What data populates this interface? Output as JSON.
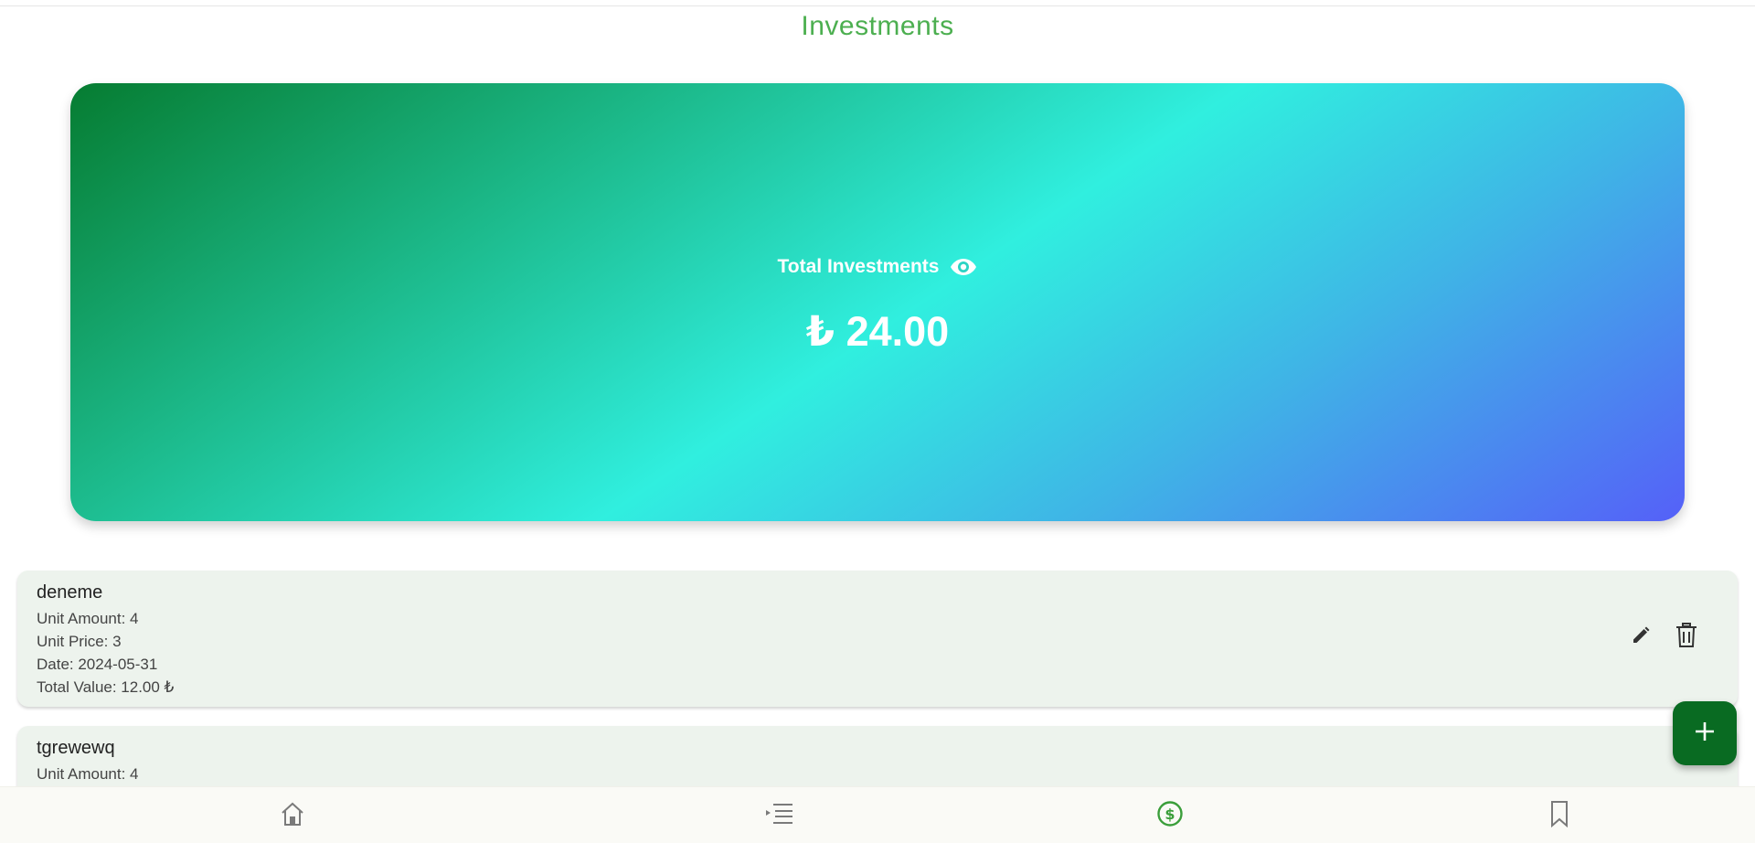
{
  "page": {
    "title": "Investments"
  },
  "summary": {
    "label": "Total Investments",
    "value": "₺ 24.00",
    "visibility_icon": "eye-icon"
  },
  "investments": [
    {
      "name": "deneme",
      "unit_amount": "Unit Amount: 4",
      "unit_price": "Unit Price: 3",
      "date": "Date: 2024-05-31",
      "total_value": "Total Value: 12.00 ₺"
    },
    {
      "name": "tgrewewq",
      "unit_amount": "Unit Amount: 4"
    }
  ],
  "icons": {
    "edit": "pencil-icon",
    "delete": "trash-icon",
    "add": "plus-icon",
    "nav": [
      "home-icon",
      "list-icon",
      "dollar-icon",
      "bookmark-icon"
    ]
  },
  "colors": {
    "title": "#4caf50",
    "fab": "#096b22",
    "nav_active": "#3a9e3a",
    "nav_inactive": "#7a7a7a",
    "card_gradient": [
      "#067c31",
      "#30efdf",
      "#5560f8"
    ]
  },
  "nav": {
    "active_index": 2
  }
}
